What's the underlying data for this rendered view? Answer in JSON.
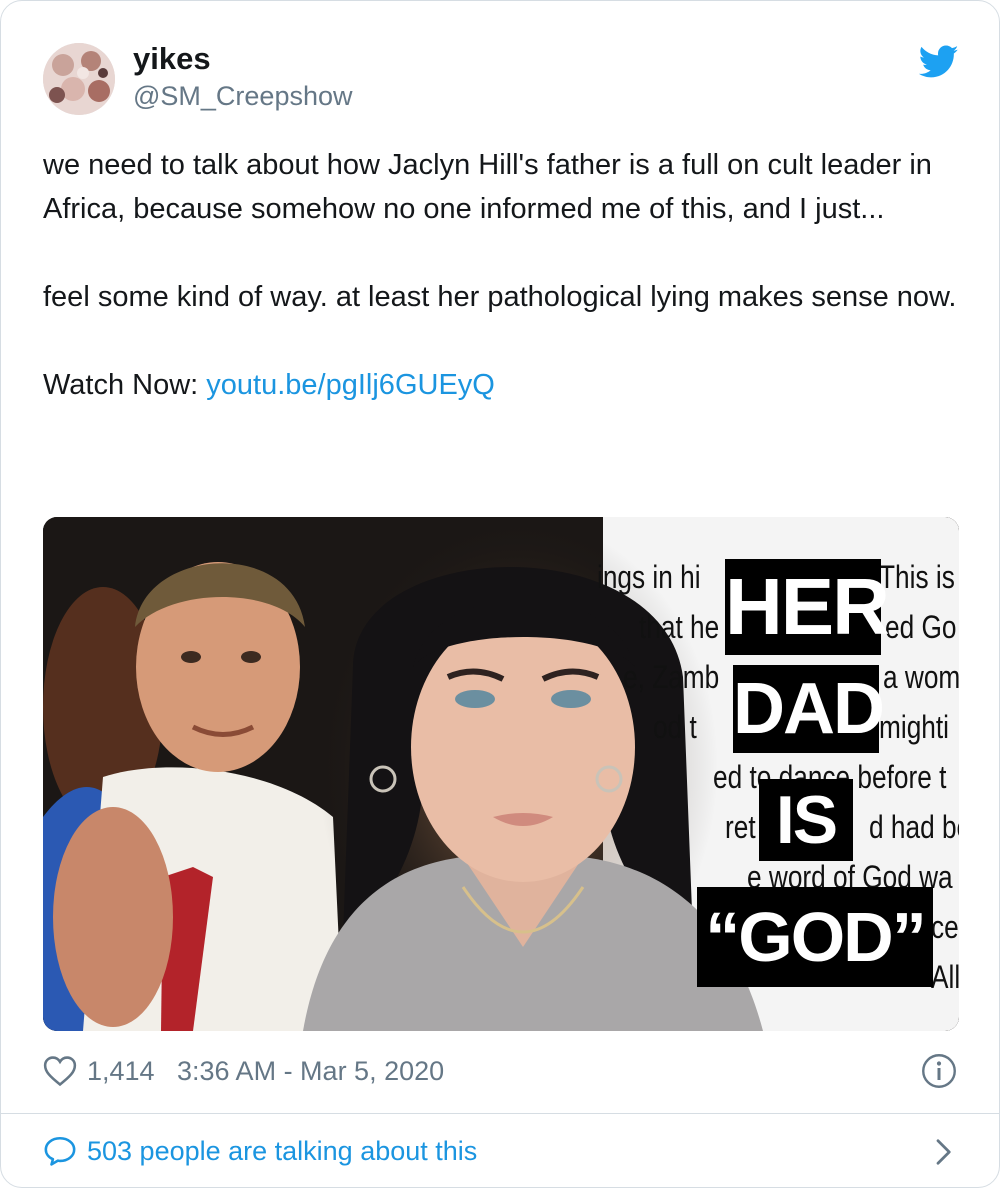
{
  "author": {
    "display_name": "yikes",
    "handle": "@SM_Creepshow"
  },
  "tweet": {
    "paragraphs": [
      "we need to talk about how Jaclyn Hill's father is a full on cult leader in Africa, because somehow no one informed me of this, and I just...",
      "feel some kind of way. at least her pathological lying makes sense now."
    ],
    "watch_label": "Watch Now: ",
    "link_text": "youtu.be/pgIlj6GUEyQ"
  },
  "media": {
    "overlay_words": [
      "HER",
      "DAD",
      "IS",
      "“GOD”"
    ],
    "background_text": [
      "ings in hi",
      "This is",
      "that he",
      "ed Go",
      "e, Zamb",
      "a wom",
      "od t",
      "mighti",
      "ed to dance before t",
      "ret",
      "d had be",
      "e word of God wa",
      "ce",
      "All"
    ]
  },
  "footer": {
    "like_count": "1,414",
    "timestamp": "3:36 AM - Mar 5, 2020"
  },
  "conversation": {
    "label": "503 people are talking about this"
  },
  "icons": {
    "brand": "twitter-bird-icon",
    "like": "heart-icon",
    "info": "info-icon",
    "reply": "speech-bubble-icon",
    "chevron": "chevron-right-icon"
  },
  "colors": {
    "twitter_blue": "#1da1f2",
    "link": "#1b95e0",
    "secondary_text": "#657786",
    "border": "#d6dde3"
  }
}
